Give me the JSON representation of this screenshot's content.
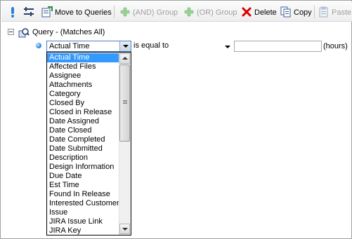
{
  "toolbar": {
    "move_to_queries_label": "Move to Queries",
    "and_group_label": "(AND) Group",
    "or_group_label": "(OR) Group",
    "delete_label": "Delete",
    "copy_label": "Copy",
    "paste_label": "Paste",
    "icons": {
      "first": "exclamation-icon",
      "second": "filter-icon",
      "move": "move-to-queries-icon",
      "and_group": "plus-icon",
      "or_group": "plus-icon",
      "delete": "red-x-icon",
      "copy": "copy-icon",
      "paste": "paste-icon"
    },
    "colors": {
      "exclamation": "#2d7fd8",
      "plus_disabled": "#9bd39b",
      "delete": "#d80000"
    }
  },
  "tree": {
    "root_label": "Query - (Matches All)"
  },
  "condition": {
    "field_value": "Actual Time",
    "operator_value": "is equal to",
    "value_input": "",
    "units": "(hours)"
  },
  "field_options": [
    "Actual Time",
    "Affected Files",
    "Assignee",
    "Attachments",
    "Category",
    "Closed By",
    "Closed in Release",
    "Date Assigned",
    "Date Closed",
    "Date Completed",
    "Date Submitted",
    "Description",
    "Design Information",
    "Due Date",
    "Est Time",
    "Found In Release",
    "Interested Customer",
    "Issue",
    "JIRA Issue Link",
    "JIRA Key"
  ],
  "selected_index": 0,
  "selection_color": "#3399ff"
}
